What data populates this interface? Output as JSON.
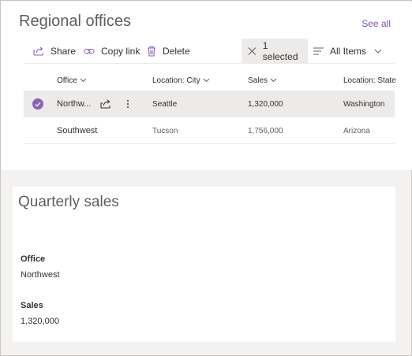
{
  "list": {
    "title": "Regional offices",
    "see_all": "See all",
    "commands": {
      "share": "Share",
      "copy_link": "Copy link",
      "delete": "Delete",
      "selected": "1 selected",
      "view": "All Items"
    },
    "columns": [
      "Office",
      "Location: City",
      "Sales",
      "Location: State"
    ],
    "rows": [
      {
        "office": "Northw...",
        "city": "Seattle",
        "sales": "1,320,000",
        "state": "Washington",
        "selected": true
      },
      {
        "office": "Southwest",
        "city": "Tucson",
        "sales": "1,756,000",
        "state": "Arizona",
        "selected": false
      }
    ]
  },
  "form": {
    "title": "Quarterly sales",
    "fields": [
      {
        "label": "Office",
        "value": "Northwest"
      },
      {
        "label": "Sales",
        "value": "1,320,000"
      }
    ]
  },
  "colors": {
    "accent": "#8764b8",
    "link": "#7b4fbf",
    "selected_row": "#edebe9"
  },
  "icons": [
    "share-icon",
    "link-icon",
    "trash-icon",
    "close-icon",
    "view-lines-icon",
    "chevron-down-icon",
    "checkmark-icon",
    "more-vertical-icon"
  ]
}
